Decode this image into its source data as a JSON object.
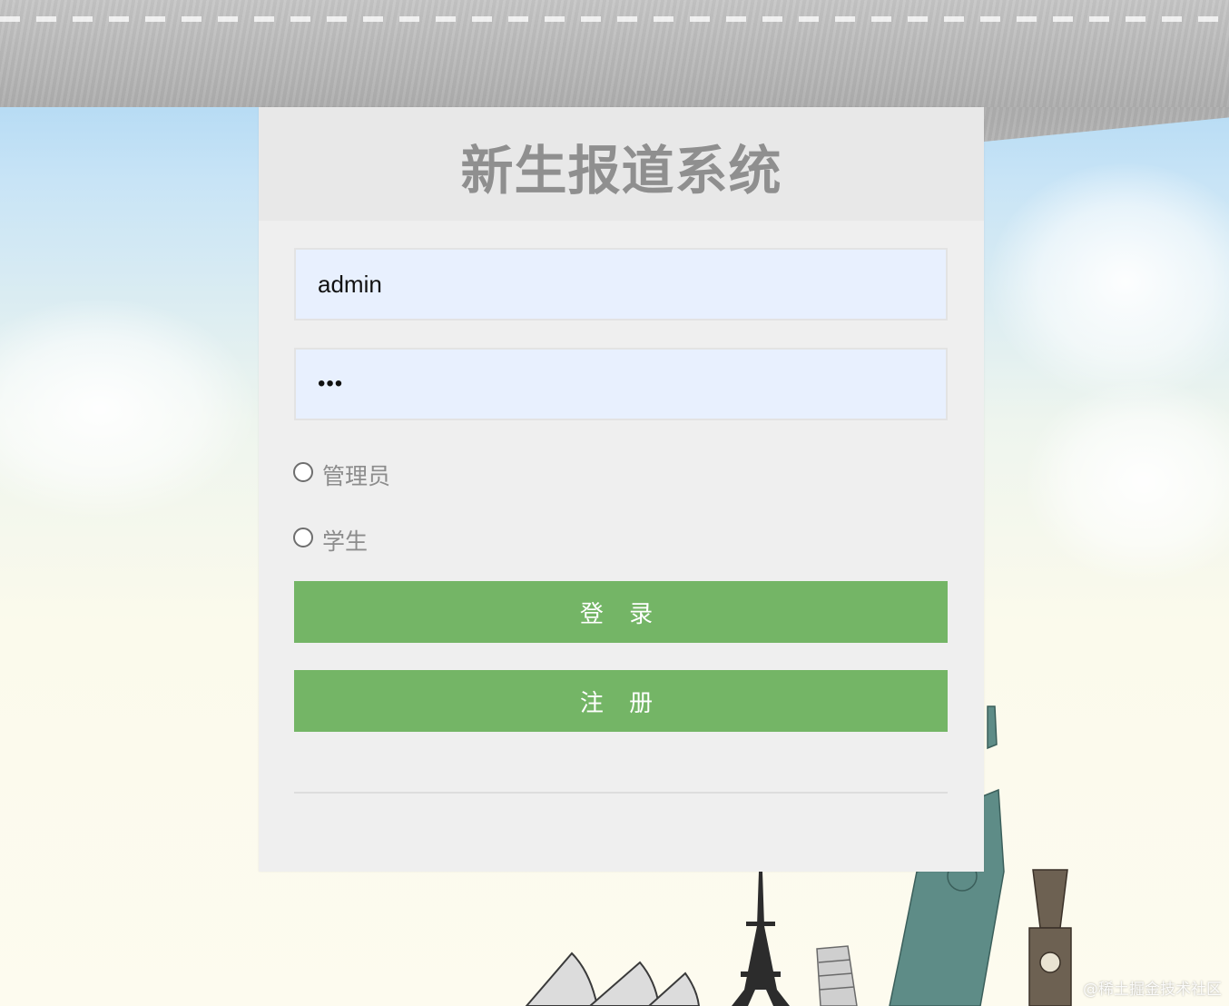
{
  "app": {
    "title": "新生报道系统"
  },
  "form": {
    "username_value": "admin",
    "password_value": "•••",
    "roles": [
      {
        "label": "管理员",
        "selected": false
      },
      {
        "label": "学生",
        "selected": false
      }
    ],
    "login_label": "登 录",
    "register_label": "注 册"
  },
  "watermark": {
    "text": "@稀土掘金技术社区"
  },
  "colors": {
    "button_green": "#74b566",
    "input_bg": "#e8f0fe",
    "card_bg": "#efefef",
    "title_gray": "#8f8f8f"
  }
}
